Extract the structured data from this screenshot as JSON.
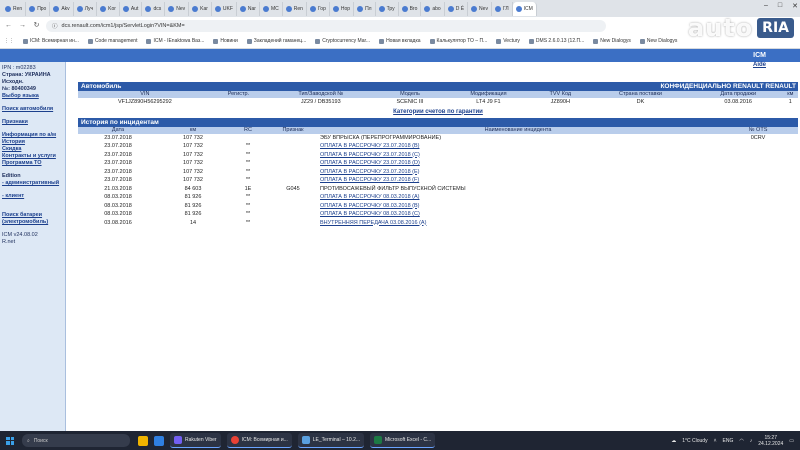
{
  "browser": {
    "tabs": [
      "Ren",
      "Про",
      "Akv",
      "Луч",
      "Kor",
      "Aut",
      "dcs",
      "Nev",
      "Kar",
      "UKF",
      "Nar",
      "MC",
      "Ren",
      "Гор",
      "Hop",
      "Пл",
      "Тру",
      "Bro",
      "abo",
      "D É",
      "Nev",
      "ГЛ",
      "ICM"
    ],
    "url": "dcs.renault.com/icm1/jsp/ServletLogin?VIN=&KM=",
    "bookmarks": [
      "ICM: Всемирная ин...",
      "Code management",
      "ICM - IEnaktowa Baз...",
      "Новини",
      "Закладений гаманец...",
      "Cryptocurrency Mar...",
      "Новая вкладка",
      "Калькулятор ТО – П...",
      "Vectury",
      "DMS 2.6.0.13 (12.П...",
      "New Dialogys",
      "New Dialogys"
    ]
  },
  "watermark": {
    "text": "auto",
    "badge": "RIA",
    "badge_color": "#3a5b8c"
  },
  "page": {
    "header_title": "ICM",
    "aide": "Aide",
    "sidebar": {
      "ipn_label": "IPN : m02283",
      "country": "Страна: УКРАИНА",
      "source_label": "Исходн.",
      "source_no": "№: 80400349",
      "language_link": "Выбор языка",
      "vehicle_search": "Поиск автомобиля",
      "signs": "Признаки",
      "info": "Информация по а/м",
      "history": "История",
      "discount": "Скидка",
      "contracts": "Контракты и услуги",
      "program": "Программа ТО",
      "edition": "Edition",
      "admin": "- административный",
      "client": "- клиент",
      "battery_search": "Поиск батареи (электромобиль)",
      "version": "ICM v24.08.02",
      "rnet": "R.net"
    },
    "vehicle": {
      "title": "Автомобиль",
      "confidential": "КОНФИДЕНЦИАЛЬНО RENAULT RENAULT",
      "headers": [
        "VIN",
        "Регистр.",
        "Тип/Заводской №",
        "Модель",
        "Модификация",
        "TVV Код",
        "Страна поставки",
        "Дата продажи",
        "км"
      ],
      "row": [
        "VF1JZ890H56295292",
        "",
        "JZ29 / DB35193",
        "SCENIC III",
        "LT4 J9 F1",
        "JZ890H",
        "DK",
        "03.08.2016",
        "1"
      ],
      "warranty_link": "Категории счетов по гарантии"
    },
    "incidents": {
      "title": "История по инцидентам",
      "headers": [
        "Дата",
        "км",
        "RC",
        "Признак",
        "Наименование инцидента",
        "№ OTS"
      ],
      "rows": [
        {
          "date": "23.07.2018",
          "km": "107 732",
          "rc": "",
          "sign": "",
          "name": "ЭБУ ВПРЫСКА (ПЕРЕПРОГРАММИРОВАНИЕ)",
          "ots": "0CRV",
          "link": false
        },
        {
          "date": "23.07.2018",
          "km": "107 732",
          "rc": "**",
          "sign": "",
          "name": "ОПЛАТА В РАССРОЧКУ 23.07.2018 (B)",
          "ots": "",
          "link": true
        },
        {
          "date": "23.07.2018",
          "km": "107 732",
          "rc": "**",
          "sign": "",
          "name": "ОПЛАТА В РАССРОЧКУ 23.07.2018 (C)",
          "ots": "",
          "link": true
        },
        {
          "date": "23.07.2018",
          "km": "107 732",
          "rc": "**",
          "sign": "",
          "name": "ОПЛАТА В РАССРОЧКУ 23.07.2018 (D)",
          "ots": "",
          "link": true
        },
        {
          "date": "23.07.2018",
          "km": "107 732",
          "rc": "**",
          "sign": "",
          "name": "ОПЛАТА В РАССРОЧКУ 23.07.2018 (E)",
          "ots": "",
          "link": true
        },
        {
          "date": "23.07.2018",
          "km": "107 732",
          "rc": "**",
          "sign": "",
          "name": "ОПЛАТА В РАССРОЧКУ 23.07.2018 (F)",
          "ots": "",
          "link": true
        },
        {
          "date": "21.03.2018",
          "km": "84 603",
          "rc": "1E",
          "sign": "G045",
          "name": "ПРОТИВОСАЖЕВЫЙ ФИЛЬТР ВЫПУСКНОЙ СИСТЕМЫ",
          "ots": "",
          "link": false
        },
        {
          "date": "08.03.2018",
          "km": "81 926",
          "rc": "**",
          "sign": "",
          "name": "ОПЛАТА В РАССРОЧКУ 08.03.2018 (A)",
          "ots": "",
          "link": true
        },
        {
          "date": "08.03.2018",
          "km": "81 926",
          "rc": "**",
          "sign": "",
          "name": "ОПЛАТА В РАССРОЧКУ 08.03.2018 (B)",
          "ots": "",
          "link": true
        },
        {
          "date": "08.03.2018",
          "km": "81 926",
          "rc": "**",
          "sign": "",
          "name": "ОПЛАТА В РАССРОЧКУ 08.03.2018 (C)",
          "ots": "",
          "link": true
        },
        {
          "date": "03.08.2016",
          "km": "14",
          "rc": "**",
          "sign": "",
          "name": "ВНУТРЕННЯЯ ПЕРЕДАЧА 03.08.2016 (A)",
          "ots": "",
          "link": true
        }
      ]
    }
  },
  "taskbar": {
    "search_placeholder": "Поиск",
    "apps": [
      "Rakuten Viber",
      "ICM: Всемирная и...",
      "LE_Terminal – 10.2...",
      "Microsoft Excel - C..."
    ],
    "weather": "1°C Cloudy",
    "lang": "ENG",
    "time": "15:27",
    "date": "24.12.2024"
  }
}
